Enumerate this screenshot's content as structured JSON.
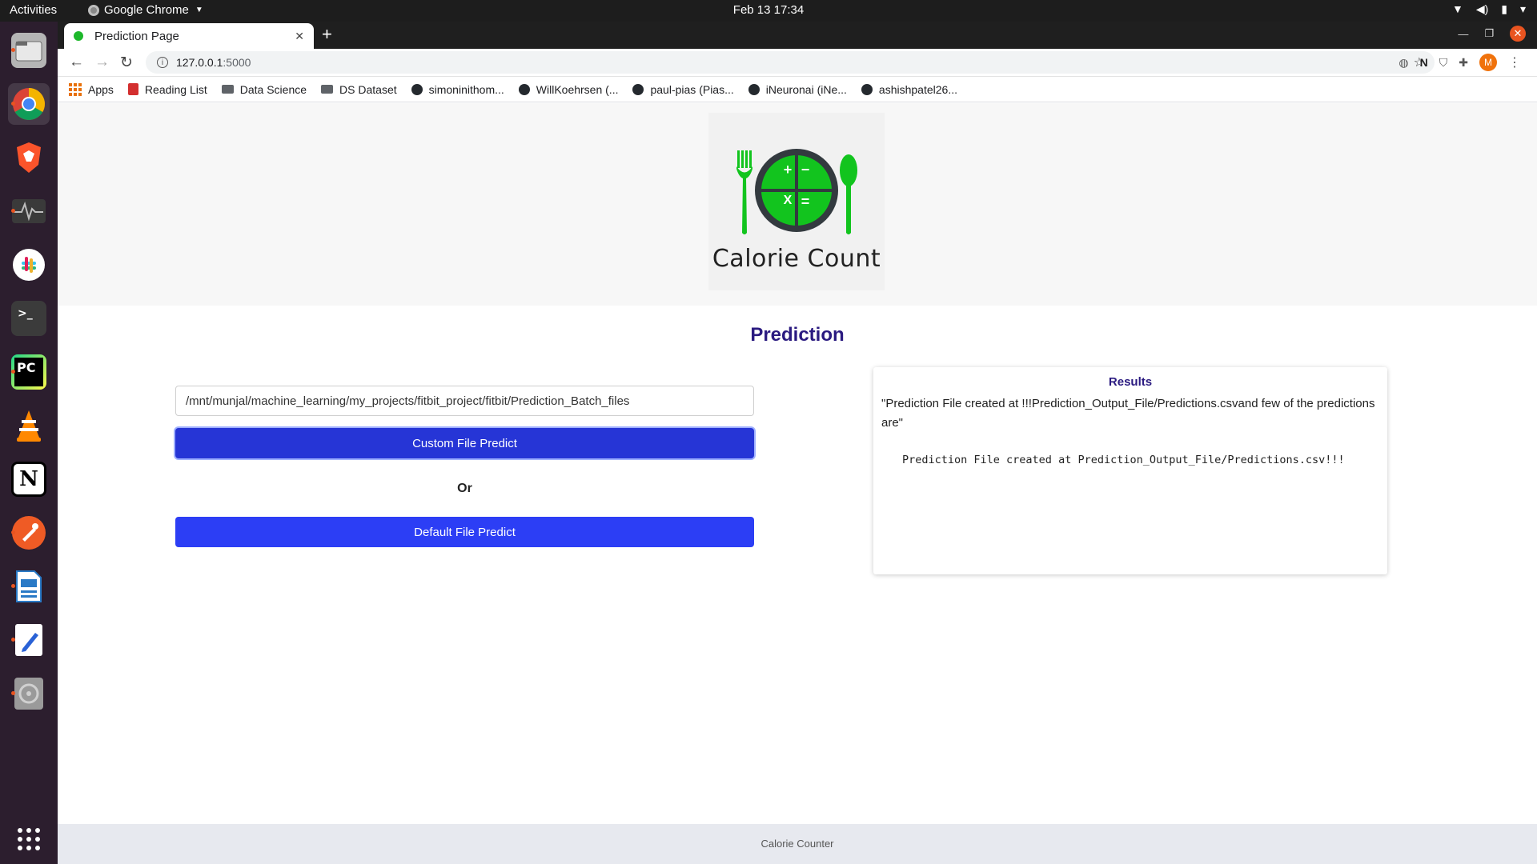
{
  "system": {
    "activities": "Activities",
    "app_name": "Google Chrome",
    "clock": "Feb 13  17:34"
  },
  "browser": {
    "tab_title": "Prediction Page",
    "url_host": "127.0.0.1",
    "url_port": ":5000",
    "profile_initial": "M",
    "bookmarks": [
      {
        "label": "Apps",
        "icon": "apps-grid-icon"
      },
      {
        "label": "Reading List",
        "icon": "reading-list-icon"
      },
      {
        "label": "Data Science",
        "icon": "folder-icon"
      },
      {
        "label": "DS Dataset",
        "icon": "folder-icon"
      },
      {
        "label": "simoninithom...",
        "icon": "github-icon"
      },
      {
        "label": "WillKoehrsen (...",
        "icon": "github-icon"
      },
      {
        "label": "paul-pias (Pias...",
        "icon": "github-icon"
      },
      {
        "label": "iNeuronai (iNe...",
        "icon": "github-icon"
      },
      {
        "label": "ashishpatel26...",
        "icon": "github-icon"
      }
    ]
  },
  "dock": {
    "items": [
      "files-icon",
      "chrome-icon",
      "brave-icon",
      "system-monitor-icon",
      "slack-icon",
      "terminal-icon",
      "pycharm-icon",
      "vlc-icon",
      "notion-icon",
      "postman-icon",
      "libreoffice-writer-icon",
      "text-editor-icon",
      "disk-icon",
      "show-apps-icon"
    ]
  },
  "page": {
    "logo_text": "Calorie Count",
    "logo_symbols": {
      "plus": "+",
      "minus": "−",
      "times": "X",
      "equals": "="
    },
    "title": "Prediction",
    "path_value": "/mnt/munjal/machine_learning/my_projects/fitbit_project/fitbit/Prediction_Batch_files",
    "custom_button": "Custom File Predict",
    "or_label": "Or",
    "default_button": "Default File Predict",
    "results": {
      "heading": "Results",
      "message": "\"Prediction File created at !!!Prediction_Output_File/Predictions.csvand few of the predictions are\"",
      "detail": "Prediction File created at Prediction_Output_File/Predictions.csv!!!"
    },
    "footer": "Calorie Counter"
  },
  "colors": {
    "accent": "#2c3ef5",
    "title": "#2a1a80",
    "logo_green": "#12c41e",
    "ubuntu_orange": "#e95420"
  }
}
